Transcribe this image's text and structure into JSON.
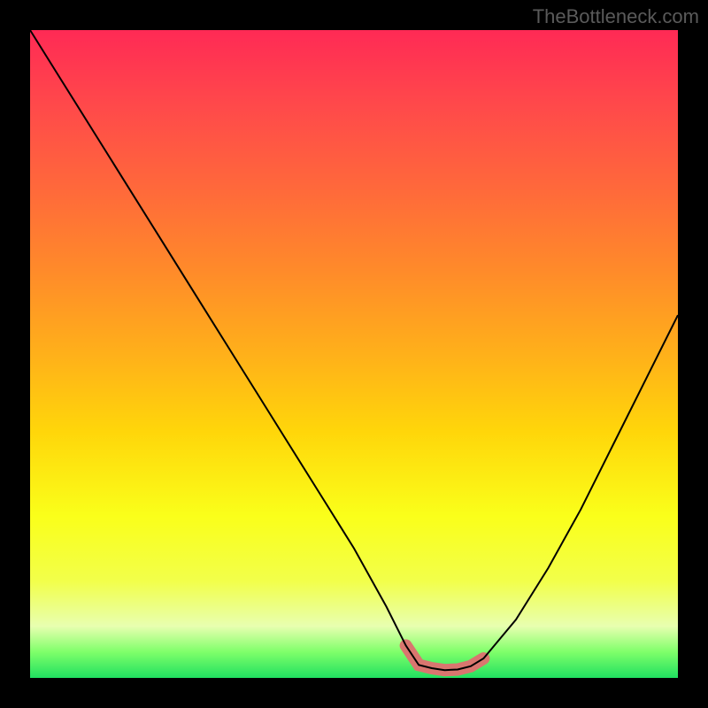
{
  "watermark": "TheBottleneck.com",
  "chart_data": {
    "type": "line",
    "title": "",
    "xlabel": "",
    "ylabel": "",
    "xlim": [
      0,
      100
    ],
    "ylim": [
      0,
      100
    ],
    "grid": false,
    "series": [
      {
        "name": "bottleneck-curve",
        "x": [
          0,
          5,
          10,
          15,
          20,
          25,
          30,
          35,
          40,
          45,
          50,
          55,
          58,
          60,
          62,
          64,
          66,
          68,
          70,
          75,
          80,
          85,
          90,
          95,
          100
        ],
        "values": [
          100,
          92,
          84,
          76,
          68,
          60,
          52,
          44,
          36,
          28,
          20,
          11,
          5,
          2,
          1.5,
          1.2,
          1.3,
          1.8,
          3,
          9,
          17,
          26,
          36,
          46,
          56
        ]
      },
      {
        "name": "optimal-zone-highlight",
        "x": [
          58,
          60,
          62,
          64,
          66,
          68,
          70
        ],
        "values": [
          5,
          2,
          1.5,
          1.2,
          1.3,
          1.8,
          3
        ]
      }
    ],
    "colors": {
      "curve": "#000000",
      "highlight": "#d9766f",
      "gradient_top": "#ff2a55",
      "gradient_bottom": "#20e060"
    }
  }
}
